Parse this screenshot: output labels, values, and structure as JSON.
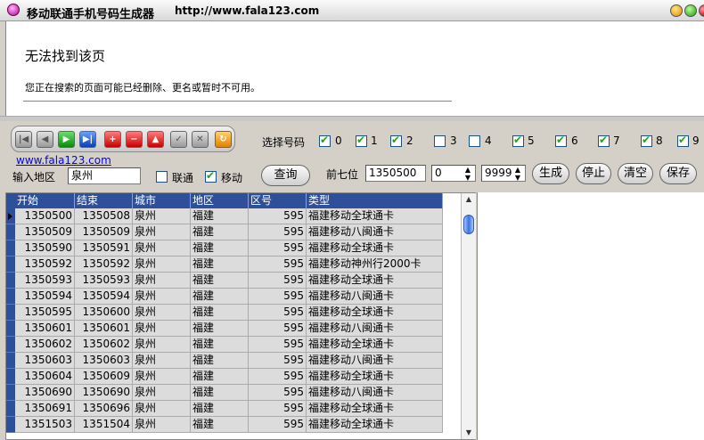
{
  "window": {
    "title": "移动联通手机号码生成器",
    "url": "http://www.fala123.com"
  },
  "browser": {
    "error_title": "无法找到该页",
    "error_message": "您正在搜索的页面可能已经删除、更名或暂时不可用。"
  },
  "toolbar": {
    "buttons": [
      "first",
      "prev",
      "play",
      "next",
      "add",
      "remove",
      "up",
      "ok",
      "cancel",
      "refresh"
    ],
    "icons": [
      "skip-first-icon",
      "step-back-icon",
      "play-icon",
      "step-forward-icon",
      "plus-icon",
      "minus-icon",
      "triangle-up-icon",
      "check-icon",
      "cross-icon",
      "refresh-icon"
    ]
  },
  "selector": {
    "label": "选择号码",
    "options": [
      {
        "label": "0",
        "checked": true
      },
      {
        "label": "1",
        "checked": true
      },
      {
        "label": "2",
        "checked": true
      },
      {
        "label": "3",
        "checked": false
      },
      {
        "label": "4",
        "checked": false
      },
      {
        "label": "5",
        "checked": true
      },
      {
        "label": "6",
        "checked": true
      },
      {
        "label": "7",
        "checked": true
      },
      {
        "label": "8",
        "checked": true
      },
      {
        "label": "9",
        "checked": true
      }
    ]
  },
  "form": {
    "link_text": "www.fala123.com",
    "region_label": "输入地区",
    "region_value": "泉州",
    "unicom_label": "联通",
    "unicom_checked": false,
    "mobile_label": "移动",
    "mobile_checked": true,
    "query_button": "查询",
    "prefix_label": "前七位",
    "prefix_value": "1350500",
    "start_value": "0",
    "end_value": "9999",
    "generate_button": "生成",
    "stop_button": "停止",
    "clear_button": "清空",
    "save_button": "保存"
  },
  "grid": {
    "columns": [
      "开始",
      "结束",
      "城市",
      "地区",
      "区号",
      "类型"
    ],
    "rows": [
      [
        "1350500",
        "1350508",
        "泉州",
        "福建",
        "595",
        "福建移动全球通卡"
      ],
      [
        "1350509",
        "1350509",
        "泉州",
        "福建",
        "595",
        "福建移动八闽通卡"
      ],
      [
        "1350590",
        "1350591",
        "泉州",
        "福建",
        "595",
        "福建移动全球通卡"
      ],
      [
        "1350592",
        "1350592",
        "泉州",
        "福建",
        "595",
        "福建移动神州行2000卡"
      ],
      [
        "1350593",
        "1350593",
        "泉州",
        "福建",
        "595",
        "福建移动全球通卡"
      ],
      [
        "1350594",
        "1350594",
        "泉州",
        "福建",
        "595",
        "福建移动八闽通卡"
      ],
      [
        "1350595",
        "1350600",
        "泉州",
        "福建",
        "595",
        "福建移动全球通卡"
      ],
      [
        "1350601",
        "1350601",
        "泉州",
        "福建",
        "595",
        "福建移动八闽通卡"
      ],
      [
        "1350602",
        "1350602",
        "泉州",
        "福建",
        "595",
        "福建移动全球通卡"
      ],
      [
        "1350603",
        "1350603",
        "泉州",
        "福建",
        "595",
        "福建移动八闽通卡"
      ],
      [
        "1350604",
        "1350609",
        "泉州",
        "福建",
        "595",
        "福建移动全球通卡"
      ],
      [
        "1350690",
        "1350690",
        "泉州",
        "福建",
        "595",
        "福建移动八闽通卡"
      ],
      [
        "1350691",
        "1350696",
        "泉州",
        "福建",
        "595",
        "福建移动全球通卡"
      ],
      [
        "1351503",
        "1351504",
        "泉州",
        "福建",
        "595",
        "福建移动全球通卡"
      ]
    ]
  }
}
